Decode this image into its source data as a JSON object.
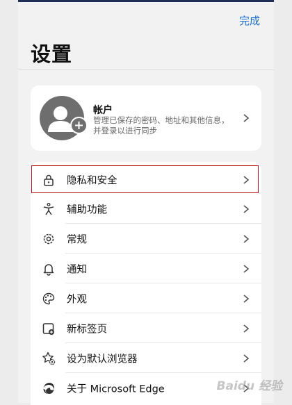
{
  "header": {
    "done_label": "完成",
    "title": "设置"
  },
  "account": {
    "title": "帐户",
    "description": "管理已保存的密码、地址和其他信息，并登录以进行同步"
  },
  "settings_items": [
    {
      "label": "隐私和安全",
      "icon": "lock-icon"
    },
    {
      "label": "辅助功能",
      "icon": "accessibility-icon"
    },
    {
      "label": "常规",
      "icon": "gear-icon"
    },
    {
      "label": "通知",
      "icon": "bell-icon"
    },
    {
      "label": "外观",
      "icon": "palette-icon"
    },
    {
      "label": "新标签页",
      "icon": "new-tab-icon"
    },
    {
      "label": "设为默认浏览器",
      "icon": "star-gear-icon"
    },
    {
      "label": "关于 Microsoft Edge",
      "icon": "edge-logo-icon"
    }
  ],
  "highlighted_item": "隐私和安全",
  "colors": {
    "accent": "#1a6fd6",
    "highlight": "#c0151b",
    "avatar": "#6e6e6e"
  },
  "watermark": "Baidu 经验"
}
